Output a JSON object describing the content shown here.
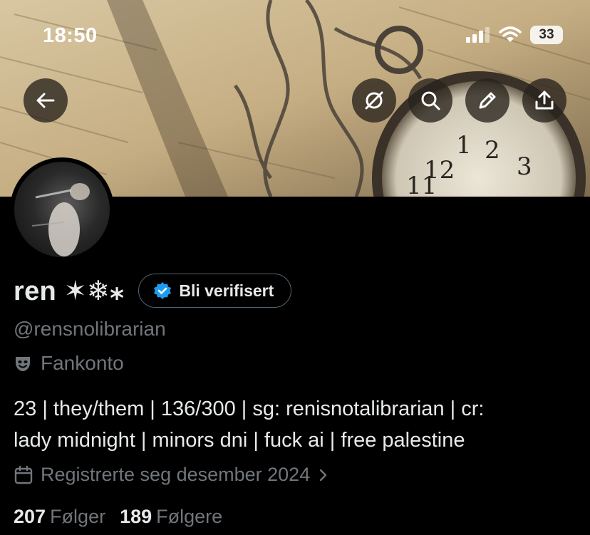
{
  "status_bar": {
    "time": "18:50",
    "battery_level": "33",
    "icons": [
      "signal-icon",
      "wifi-icon",
      "battery-icon"
    ]
  },
  "banner": {
    "description_icons": [
      "back-arrow-icon",
      "disabled-circle-icon",
      "search-icon",
      "edit-pencil-icon",
      "share-upload-icon"
    ]
  },
  "profile": {
    "display_name": "ren ✶❄︎⁎",
    "verify_button_label": "Bli verifisert",
    "handle": "@rensnolibrarian",
    "category_label": "Fankonto",
    "bio_line_1": "23 | they/them | 136/300 | sg: renisnotalibrarian | cr:",
    "bio_line_2": "lady midnight | minors dni | fuck ai | free palestine",
    "joined_label": "Registrerte seg desember 2024",
    "following_count": "207",
    "following_label": "Følger",
    "followers_count": "189",
    "followers_label": "Følgere"
  },
  "colors": {
    "background": "#000000",
    "primary_text": "#e7e9ea",
    "secondary_text": "#71767b",
    "verified_badge": "#1d9bf0",
    "button_border": "#536471"
  }
}
